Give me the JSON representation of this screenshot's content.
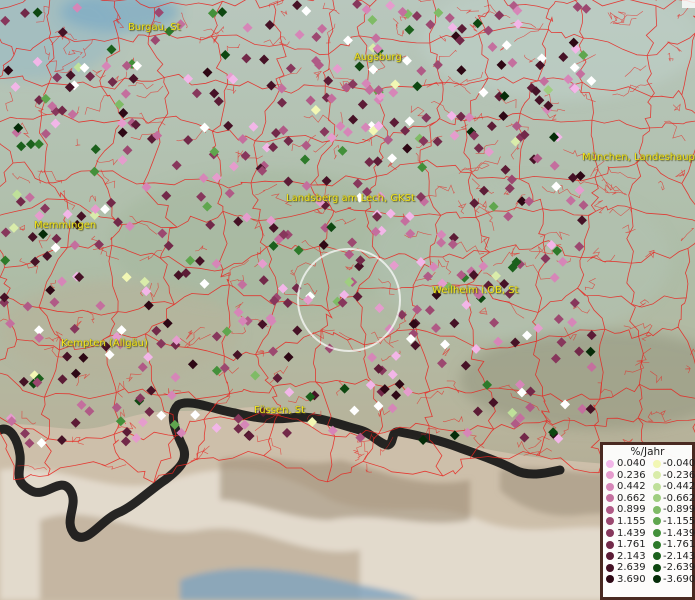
{
  "map": {
    "places": [
      "Burgau, St",
      "Augsburg",
      "München, Landeshaupt",
      "Landsberg am Lech, GKSt",
      "Memmingen",
      "Weilheim i.OB, St",
      "Kempten (Allgäu)",
      "Füssen, St"
    ],
    "legend": {
      "title": "%/Jahr",
      "positive": [
        {
          "label": "0.040",
          "color": "#f2b6e8"
        },
        {
          "label": "0.236",
          "color": "#e59ccd"
        },
        {
          "label": "0.442",
          "color": "#d686b8"
        },
        {
          "label": "0.662",
          "color": "#c46f9e"
        },
        {
          "label": "0.899",
          "color": "#b05a86"
        },
        {
          "label": "1.155",
          "color": "#9c4870"
        },
        {
          "label": "1.439",
          "color": "#87375c"
        },
        {
          "label": "1.761",
          "color": "#722949"
        },
        {
          "label": "2.143",
          "color": "#5c1c36"
        },
        {
          "label": "2.639",
          "color": "#461226"
        },
        {
          "label": "3.690",
          "color": "#2e0815"
        }
      ],
      "negative": [
        {
          "label": "-0.040",
          "color": "#f2f7b4"
        },
        {
          "label": "-0.236",
          "color": "#d9ecaa"
        },
        {
          "label": "-0.442",
          "color": "#bfe09a"
        },
        {
          "label": "-0.662",
          "color": "#9fce80"
        },
        {
          "label": "-0.899",
          "color": "#7fbb66"
        },
        {
          "label": "-1.155",
          "color": "#5fa64e"
        },
        {
          "label": "-1.439",
          "color": "#43903a"
        },
        {
          "label": "-1.761",
          "color": "#2d7a2a"
        },
        {
          "label": "-2.143",
          "color": "#1b601c"
        },
        {
          "label": "-2.639",
          "color": "#0e4711"
        },
        {
          "label": "-3.690",
          "color": "#052c08"
        }
      ]
    }
  }
}
